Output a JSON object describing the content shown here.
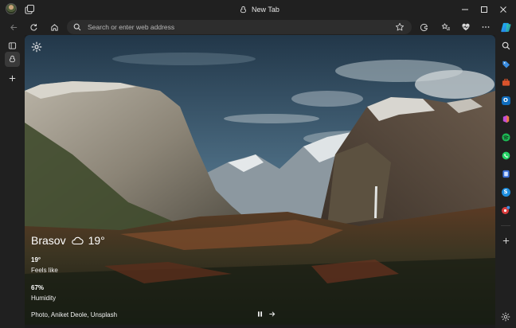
{
  "window": {
    "tab_title": "New Tab"
  },
  "toolbar": {
    "address_placeholder": "Search or enter web address"
  },
  "weather": {
    "city": "Brasov",
    "temperature": "19°",
    "condition_icon": "cloud-icon",
    "stats": [
      {
        "value": "19°",
        "label": "Feels like"
      },
      {
        "value": "67%",
        "label": "Humidity"
      }
    ]
  },
  "photo": {
    "credit": "Photo, Aniket Deole, Unsplash"
  },
  "sidebar_right": {
    "icons": [
      "search-icon",
      "tag-icon",
      "briefcase-icon",
      "outlook-icon",
      "m365-icon",
      "spotify-icon",
      "whatsapp-icon",
      "phone-icon",
      "skype-icon",
      "notification-app-icon",
      "add-icon",
      "settings-icon"
    ],
    "colors": {
      "tag": "#3b8de0",
      "briefcase": "#d9532c",
      "outlook": "#0f6cbd",
      "m365": "#c24fd9",
      "spotify": "#1db954",
      "whatsapp": "#25d366",
      "phone": "#3a6fd8",
      "skype": "#1e8fe0",
      "notify": "#d83b3b"
    }
  }
}
